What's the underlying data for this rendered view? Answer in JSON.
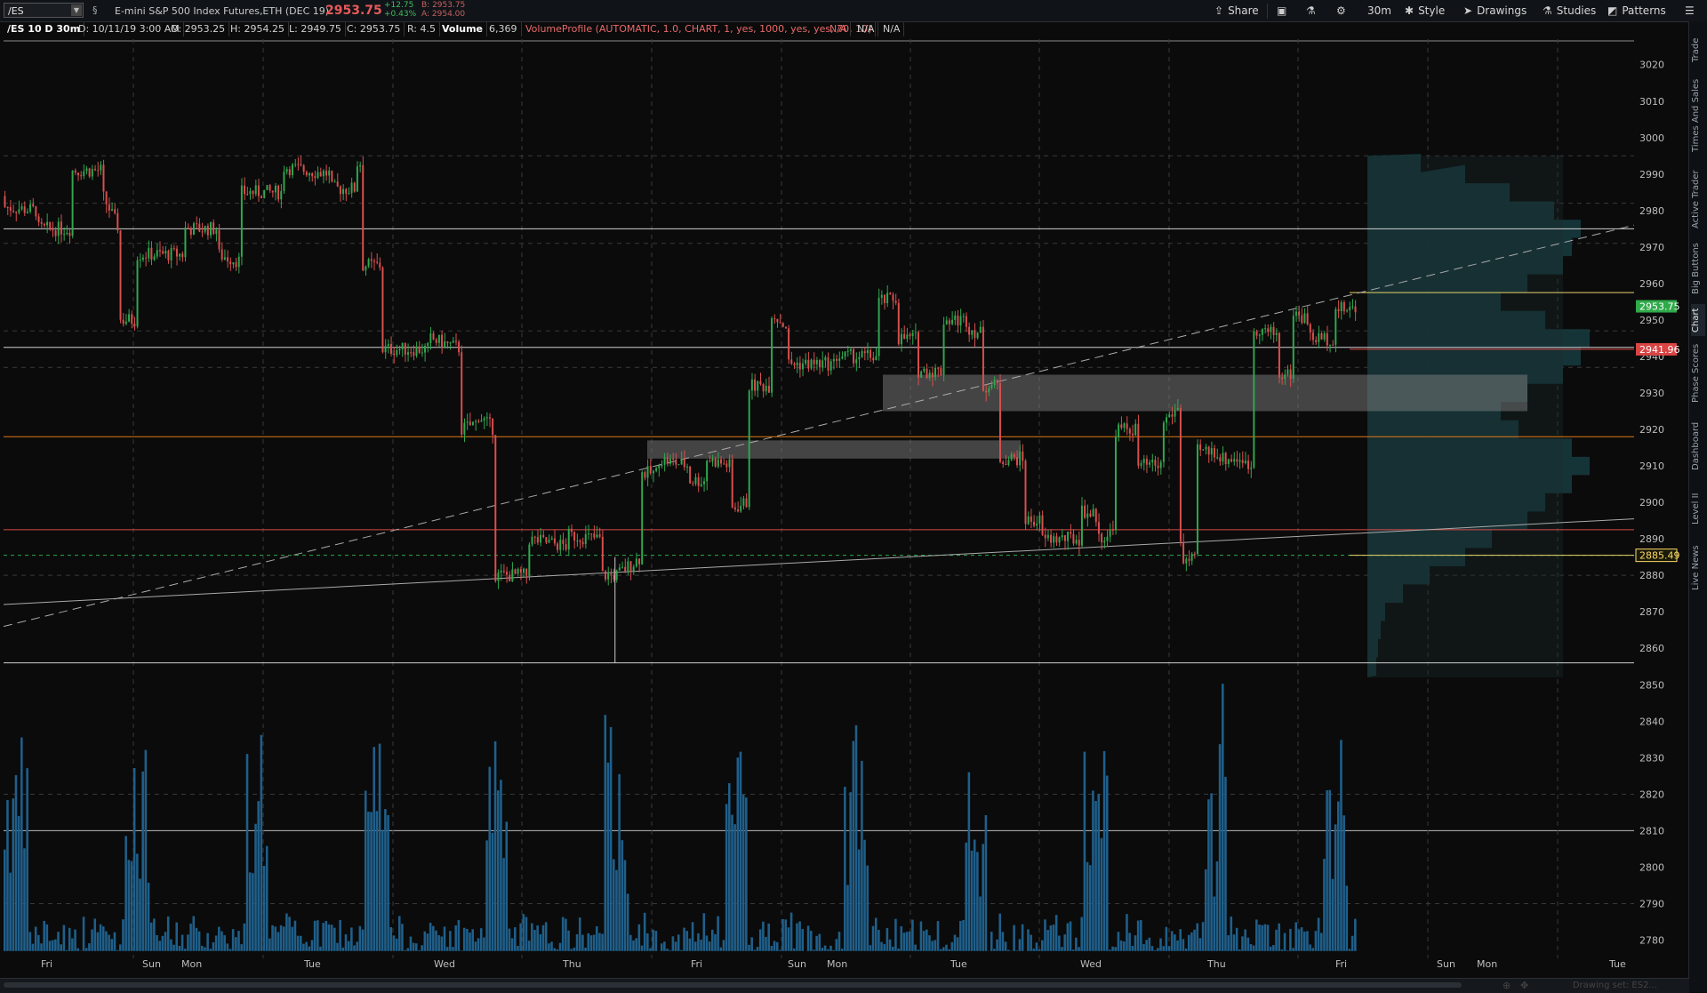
{
  "toolbar": {
    "symbol": "/ES",
    "description": "E-mini S&P 500 Index Futures,ETH (DEC 19)",
    "last_price": "2953.75",
    "net_change": "+12.75",
    "pct_change": "+0.43%",
    "bid": "B: 2953.75",
    "ask": "A: 2954.00",
    "share_label": "Share",
    "timeframe_label": "30m",
    "style_label": "Style",
    "drawings_label": "Drawings",
    "studies_label": "Studies",
    "patterns_label": "Patterns"
  },
  "infobar": {
    "period": "/ES 10 D 30m",
    "date": "D: 10/11/19 3:00 AM",
    "open": "O: 2953.25",
    "high": "H: 2954.25",
    "low": "L: 2949.75",
    "close": "C: 2953.75",
    "range": "R: 4.5",
    "volume_label": "Volume",
    "volume_value": "6,369",
    "study": "VolumeProfile (AUTOMATIC, 1.0, CHART, 1, yes, 1000, yes, yes, 70, 10)",
    "na1": "N/A",
    "na2": "N/A",
    "na3": "N/A"
  },
  "sidebar": {
    "tabs": [
      "Trade",
      "Times And Sales",
      "Active Trader",
      "Big Buttons",
      "Chart",
      "Phase Scores",
      "Dashboard",
      "Level II",
      "Live News"
    ]
  },
  "bottombar": {
    "drawing_set": "Drawing set: ES2..."
  },
  "colors": {
    "up": "#2fa84f",
    "down": "#d94f4f",
    "volume": "#1f5f8a",
    "profile": "#15393d",
    "price_tag_green": "#2faa4a",
    "price_tag_red": "#d94444",
    "price_tag_yellow": "#ffd966"
  },
  "chart_data": {
    "type": "candlestick",
    "price_axis_ticks": [
      "3020",
      "3010",
      "3000",
      "2990",
      "2980",
      "2970",
      "2960",
      "2950",
      "2940",
      "2930",
      "2920",
      "2910",
      "2900",
      "2890",
      "2880",
      "2870",
      "2860",
      "2850",
      "2840",
      "2830",
      "2820",
      "2810",
      "2800",
      "2790",
      "2780"
    ],
    "ylim": [
      2775,
      3027
    ],
    "x_labels": [
      "Fri",
      "Sun",
      "Mon",
      "Tue",
      "Wed",
      "Thu",
      "Fri",
      "Sun",
      "Mon",
      "Tue",
      "Wed",
      "Thu",
      "Fri",
      "Sun",
      "Mon",
      "Tue"
    ],
    "price_tags": [
      {
        "label": "2953.75",
        "price": 2953.75,
        "color": "green"
      },
      {
        "label": "2941.96",
        "price": 2941.96,
        "color": "red"
      },
      {
        "label": "2885.49",
        "price": 2885.49,
        "color": "yellow"
      }
    ],
    "horizontal_levels": [
      {
        "price": 2975,
        "style": "solid",
        "color": "white"
      },
      {
        "price": 2942.5,
        "style": "solid",
        "color": "white"
      },
      {
        "price": 2918,
        "style": "solid",
        "color": "orange"
      },
      {
        "price": 2892.5,
        "style": "solid",
        "color": "red"
      },
      {
        "price": 2885.5,
        "style": "dashed",
        "color": "green"
      },
      {
        "price": 2856,
        "style": "solid",
        "color": "white"
      }
    ],
    "anchors": [
      {
        "x": 0.0,
        "o": 2984,
        "c": 2981
      },
      {
        "x": 0.02,
        "o": 2980,
        "c": 2975
      },
      {
        "x": 0.04,
        "o": 2975,
        "c": 2991
      },
      {
        "x": 0.06,
        "o": 2991,
        "c": 2984
      },
      {
        "x": 0.07,
        "o": 2975,
        "c": 2950
      },
      {
        "x": 0.08,
        "o": 2950,
        "c": 2968
      },
      {
        "x": 0.11,
        "o": 2968,
        "c": 2975
      },
      {
        "x": 0.13,
        "o": 2975,
        "c": 2968
      },
      {
        "x": 0.145,
        "o": 2966,
        "c": 2985
      },
      {
        "x": 0.17,
        "o": 2985,
        "c": 2992
      },
      {
        "x": 0.2,
        "o": 2990,
        "c": 2986
      },
      {
        "x": 0.215,
        "o": 2986,
        "c": 2993
      },
      {
        "x": 0.218,
        "o": 2993,
        "c": 2965
      },
      {
        "x": 0.23,
        "o": 2965,
        "c": 2942
      },
      {
        "x": 0.26,
        "o": 2942,
        "c": 2945
      },
      {
        "x": 0.28,
        "o": 2942,
        "c": 2920
      },
      {
        "x": 0.29,
        "o": 2922,
        "c": 2924
      },
      {
        "x": 0.3,
        "o": 2920,
        "c": 2880
      },
      {
        "x": 0.32,
        "o": 2880,
        "c": 2890
      },
      {
        "x": 0.345,
        "o": 2888,
        "c": 2891
      },
      {
        "x": 0.365,
        "o": 2890,
        "c": 2880
      },
      {
        "x": 0.375,
        "o": 2880,
        "c": 2880
      },
      {
        "x": 0.39,
        "o": 2885,
        "c": 2908
      },
      {
        "x": 0.4,
        "o": 2908,
        "c": 2912
      },
      {
        "x": 0.42,
        "o": 2910,
        "c": 2906
      },
      {
        "x": 0.43,
        "o": 2906,
        "c": 2912
      },
      {
        "x": 0.445,
        "o": 2910,
        "c": 2898
      },
      {
        "x": 0.455,
        "o": 2900,
        "c": 2932
      },
      {
        "x": 0.47,
        "o": 2932,
        "c": 2952
      },
      {
        "x": 0.48,
        "o": 2948,
        "c": 2938
      },
      {
        "x": 0.51,
        "o": 2938,
        "c": 2940
      },
      {
        "x": 0.525,
        "o": 2940,
        "c": 2940
      },
      {
        "x": 0.535,
        "o": 2940,
        "c": 2955
      },
      {
        "x": 0.548,
        "o": 2956,
        "c": 2945
      },
      {
        "x": 0.56,
        "o": 2945,
        "c": 2936
      },
      {
        "x": 0.575,
        "o": 2936,
        "c": 2950
      },
      {
        "x": 0.59,
        "o": 2950,
        "c": 2948
      },
      {
        "x": 0.6,
        "o": 2946,
        "c": 2932
      },
      {
        "x": 0.61,
        "o": 2932,
        "c": 2912
      },
      {
        "x": 0.625,
        "o": 2912,
        "c": 2895
      },
      {
        "x": 0.635,
        "o": 2895,
        "c": 2890
      },
      {
        "x": 0.66,
        "o": 2890,
        "c": 2898
      },
      {
        "x": 0.67,
        "o": 2896,
        "c": 2890
      },
      {
        "x": 0.68,
        "o": 2892,
        "c": 2920
      },
      {
        "x": 0.695,
        "o": 2920,
        "c": 2910
      },
      {
        "x": 0.71,
        "o": 2910,
        "c": 2922
      },
      {
        "x": 0.72,
        "o": 2926,
        "c": 2890
      },
      {
        "x": 0.722,
        "o": 2890,
        "c": 2884
      },
      {
        "x": 0.73,
        "o": 2884,
        "c": 2914
      },
      {
        "x": 0.745,
        "o": 2914,
        "c": 2912
      },
      {
        "x": 0.76,
        "o": 2912,
        "c": 2910
      },
      {
        "x": 0.765,
        "o": 2910,
        "c": 2948
      },
      {
        "x": 0.78,
        "o": 2946,
        "c": 2935
      },
      {
        "x": 0.79,
        "o": 2935,
        "c": 2952
      },
      {
        "x": 0.8,
        "o": 2950,
        "c": 2945
      },
      {
        "x": 0.815,
        "o": 2945,
        "c": 2953
      },
      {
        "x": 0.83,
        "o": 2953,
        "c": 2954
      }
    ]
  }
}
